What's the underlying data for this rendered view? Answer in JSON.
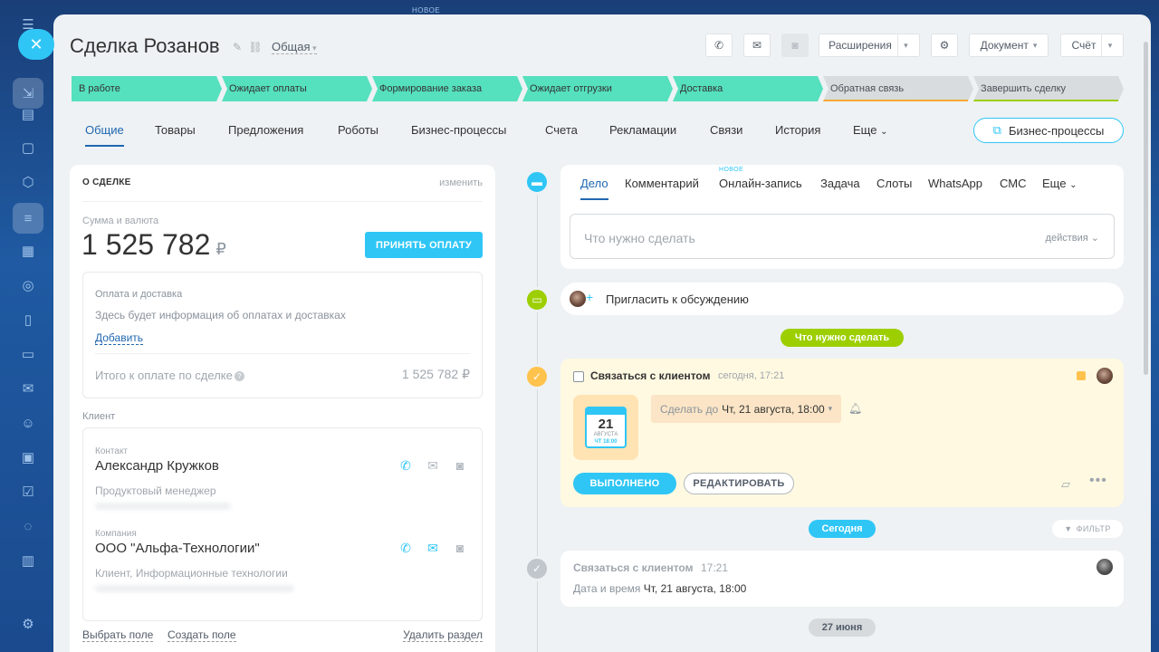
{
  "topbar": {
    "new_label": "НОВОЕ"
  },
  "deal": {
    "title": "Сделка Розанов",
    "category": "Общая"
  },
  "header_buttons": {
    "extensions": "Расширения",
    "document": "Документ",
    "invoice": "Счёт"
  },
  "stages": [
    {
      "label": "В работе",
      "state": "done"
    },
    {
      "label": "Ожидает оплаты",
      "state": "done"
    },
    {
      "label": "Формирование заказа",
      "state": "done"
    },
    {
      "label": "Ожидает отгрузки",
      "state": "done"
    },
    {
      "label": "Доставка",
      "state": "done"
    },
    {
      "label": "Обратная связь",
      "state": "todo",
      "color": "#f7a934"
    },
    {
      "label": "Завершить сделку",
      "state": "todo",
      "color": "#9dcf00"
    }
  ],
  "tabs": [
    "Общие",
    "Товары",
    "Предложения",
    "Роботы",
    "Бизнес-процессы",
    "Счета",
    "Рекламации",
    "Связи",
    "История",
    "Еще"
  ],
  "bp_button": "Бизнес-процессы",
  "about": {
    "header": "О СДЕЛКЕ",
    "edit": "изменить",
    "sum_label": "Сумма и валюта",
    "sum": "1 525 782",
    "currency": "₽",
    "pay_button": "ПРИНЯТЬ ОПЛАТУ",
    "payment": {
      "title": "Оплата и доставка",
      "info": "Здесь будет информация об оплатах и доставках",
      "add": "Добавить",
      "total_label": "Итого к оплате по сделке",
      "total": "1 525 782 ₽"
    },
    "client_label": "Клиент",
    "contact": {
      "label": "Контакт",
      "name": "Александр Кружков",
      "position": "Продуктовый менеджер"
    },
    "company": {
      "label": "Компания",
      "name": "ООО \"Альфа-Технологии\"",
      "type": "Клиент, Информационные технологии"
    },
    "footer": {
      "choose": "Выбрать поле",
      "create": "Создать поле",
      "delete": "Удалить раздел"
    }
  },
  "editor": {
    "tabs": [
      "Дело",
      "Комментарий",
      "Онлайн-запись",
      "Задача",
      "Слоты",
      "WhatsApp",
      "СМС",
      "Еще"
    ],
    "new_tag": "НОВОЕ",
    "placeholder": "Что нужно сделать",
    "actions": "действия"
  },
  "invite": "Пригласить к обсуждению",
  "todo_pill": "Что нужно сделать",
  "task": {
    "title": "Связаться с клиентом",
    "time": "сегодня, 17:21",
    "day": "21",
    "month": "АВГУСТА",
    "cal_time": "ЧТ 18:00",
    "deadline_label": "Сделать до",
    "deadline": "Чт, 21 августа, 18:00",
    "done": "ВЫПОЛНЕНО",
    "edit": "РЕДАКТИРОВАТЬ"
  },
  "today_pill": "Сегодня",
  "filter": "ФИЛЬТР",
  "history_item": {
    "title": "Связаться с клиентом",
    "time": "17:21",
    "label": "Дата и время",
    "value": "Чт, 21 августа, 18:00"
  },
  "date_pill": "27 июня",
  "colors": {
    "accent": "#2fc6f6",
    "stage_done": "#55e0be",
    "link": "#2067b0",
    "todo": "#9dcf00"
  }
}
